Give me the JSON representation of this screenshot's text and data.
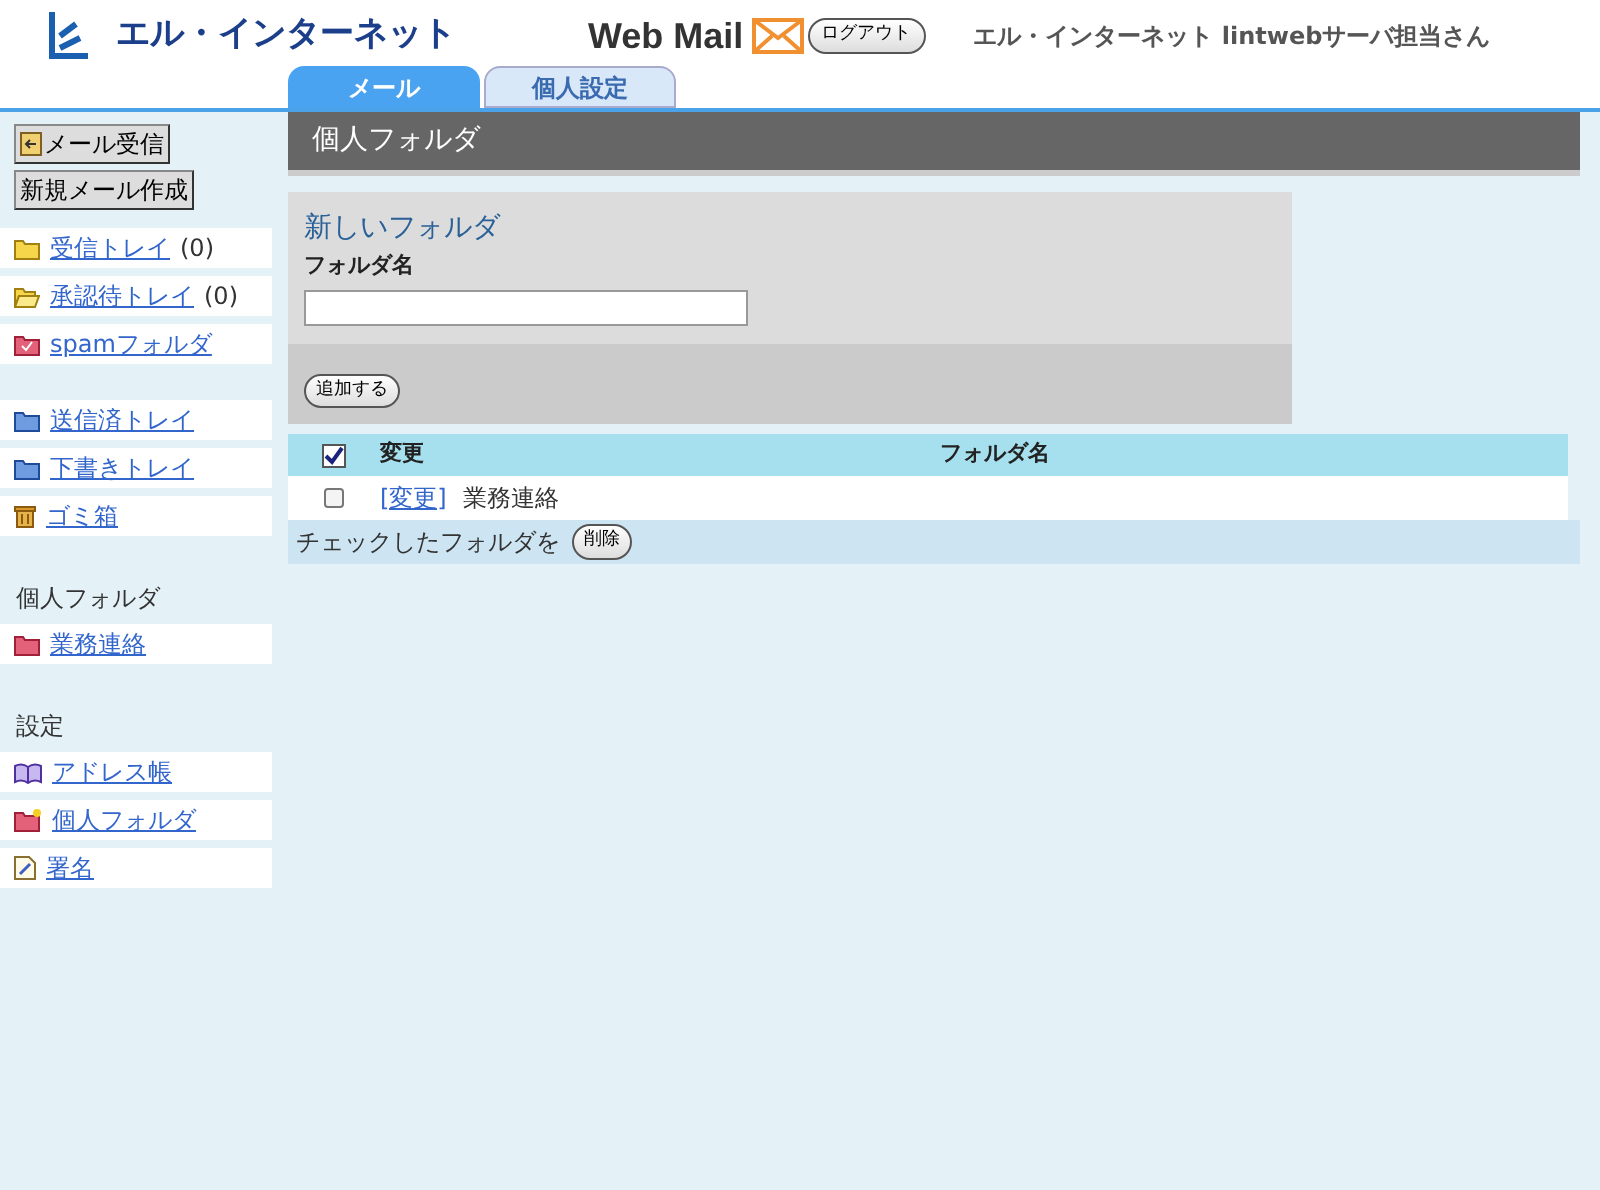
{
  "header": {
    "brand": "エル・インターネット",
    "product": "Web Mail",
    "logout": "ログアウト",
    "user": "エル・インターネット lintwebサーバ担当さん"
  },
  "tabs": [
    {
      "label": "メール",
      "selected": true
    },
    {
      "label": "個人設定",
      "selected": false
    }
  ],
  "sidebar": {
    "buttons": [
      "メール受信",
      "新規メール作成"
    ],
    "sections": [
      {
        "items": [
          {
            "kind": "folder-yellow",
            "label": "受信トレイ",
            "count": "(0)"
          },
          {
            "kind": "folder-open",
            "label": "承認待トレイ",
            "count": "(0)"
          },
          {
            "kind": "spam",
            "label": "spamフォルダ"
          }
        ]
      },
      {
        "items": [
          {
            "kind": "folder-blue",
            "label": "送信済トレイ"
          },
          {
            "kind": "folder-blue",
            "label": "下書きトレイ"
          },
          {
            "kind": "trash",
            "label": "ゴミ箱"
          }
        ]
      },
      {
        "heading": "個人フォルダ",
        "items": [
          {
            "kind": "folder-red",
            "label": "業務連絡"
          }
        ]
      },
      {
        "heading": "設定",
        "items": [
          {
            "kind": "book",
            "label": "アドレス帳"
          },
          {
            "kind": "folder-new",
            "label": "個人フォルダ"
          },
          {
            "kind": "note",
            "label": "署名"
          }
        ]
      }
    ]
  },
  "page_title": "個人フォルダ",
  "new_folder": {
    "title": "新しいフォルダ",
    "label": "フォルダ名",
    "button": "追加する"
  },
  "table": {
    "select_all_checked": true,
    "columns": [
      "変更",
      "フォルダ名"
    ],
    "rows": [
      {
        "checked": false,
        "link": "[変更]",
        "name": "業務連絡"
      }
    ],
    "footer_text": "チェックしたフォルダを",
    "footer_button": "削除"
  }
}
